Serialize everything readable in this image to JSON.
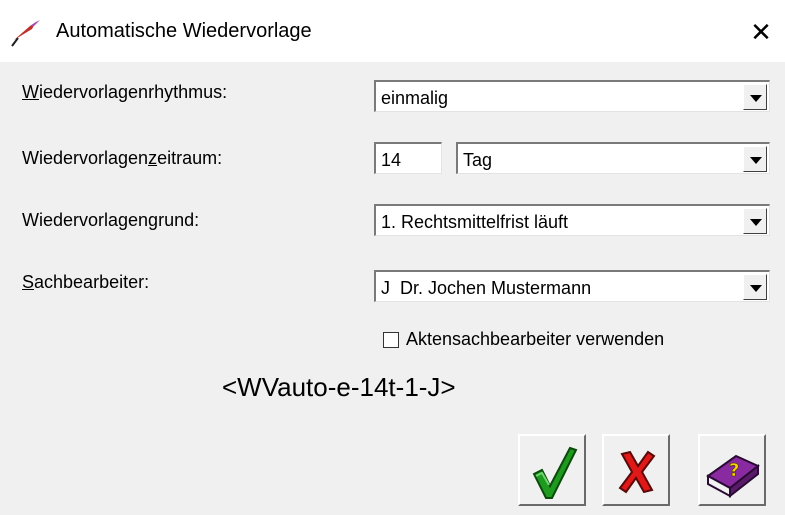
{
  "window": {
    "title": "Automatische Wiedervorlage",
    "close_glyph": "✕"
  },
  "form": {
    "rhythm": {
      "label_first": "W",
      "label_rest": "iedervorlagenrhythmus:",
      "value": "einmalig"
    },
    "period": {
      "label_pre": "Wiedervorlagen",
      "label_accel": "z",
      "label_post": "eitraum:",
      "amount": "14",
      "unit": "Tag"
    },
    "reason": {
      "label": "Wiedervorlagengrund:",
      "value": "1. Rechtsmittelfrist läuft"
    },
    "clerk": {
      "label_first": "S",
      "label_rest": "achbearbeiter:",
      "value": "J  Dr. Jochen Mustermann"
    },
    "use_file_clerk": {
      "label": "Aktensachbearbeiter verwenden",
      "checked": false
    },
    "code": "<WVauto-e-14t-1-J>"
  },
  "buttons": {
    "ok_icon": "checkmark-icon",
    "cancel_icon": "cross-icon",
    "help_icon": "help-book-icon"
  },
  "colors": {
    "ok": "#1e9a1e",
    "cancel": "#e01818",
    "help": "#8a2aa0"
  }
}
